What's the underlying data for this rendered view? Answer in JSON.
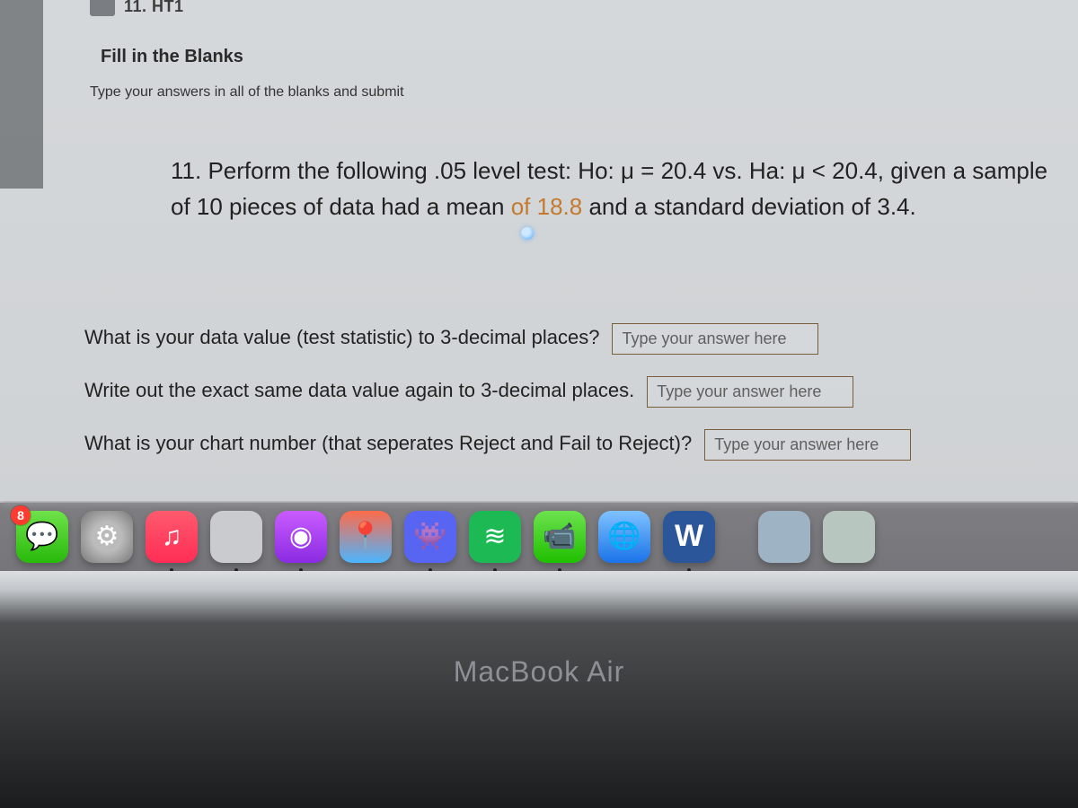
{
  "header": {
    "question_id": "11. HT1",
    "section_title": "Fill in the Blanks",
    "instructions": "Type your answers in all of the blanks and submit"
  },
  "problem": {
    "prefix": "11. Perform the following .05 level test: Ho: μ = 20.4 vs. Ha: μ < 20.4, given a sample of 10 pieces of data had a mean ",
    "highlight": "of 18.8",
    "suffix": " and a standard deviation of 3.4."
  },
  "questions": {
    "q1": "What is your data value (test statistic) to 3-decimal places?",
    "q2": "Write out the exact same data value again to 3-decimal places.",
    "q3": "What is your chart number (that seperates Reject and Fail to Reject)?"
  },
  "placeholder": "Type your answer here",
  "dock": {
    "badge": "8",
    "word_letter": "W"
  },
  "laptop": "MacBook Air"
}
